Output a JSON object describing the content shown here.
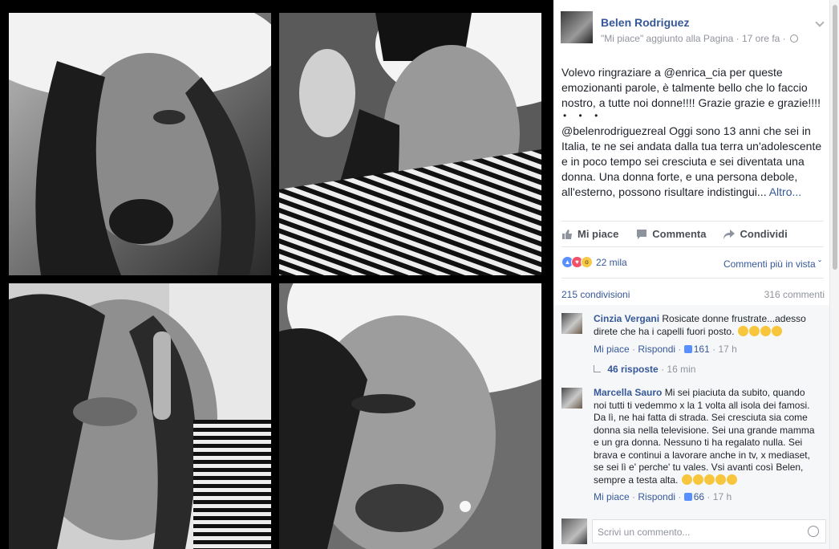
{
  "photos": [
    {
      "alt": "photo-1"
    },
    {
      "alt": "photo-2"
    },
    {
      "alt": "photo-3"
    },
    {
      "alt": "photo-4"
    }
  ],
  "post": {
    "author": "Belen Rodriguez",
    "meta": "\"Mi piace\" aggiunto alla Pagina · 17 ore fa ·",
    "text_1": "Volevo ringraziare a @enrica_cia per queste emozionanti parole, è talmente bello che lo faccio nostro, a tutte noi donne!!!! Grazie grazie e grazie!!!!",
    "dots": "• • •",
    "text_2": "@belenrodriguezreal Oggi sono 13 anni che sei in Italia, te ne sei andata dalla tua terra un'adolescente e in poco tempo sei cresciuta e sei diventata una donna. Una donna forte, e una persona debole, all'esterno, possono risultare indistingui...",
    "more": "Altro..."
  },
  "actions": {
    "like": "Mi piace",
    "comment": "Commenta",
    "share": "Condividi"
  },
  "stats": {
    "reactions": "22 mila",
    "sort": "Commenti più in vista ˇ",
    "shares": "215 condivisioni",
    "comments": "316 commenti"
  },
  "comments": [
    {
      "name": "Cinzia Vergani",
      "text": "Rosicate donne frustrate...adesso direte che ha i capelli fuori posto.",
      "like": "Mi piace",
      "reply": "Rispondi",
      "likes": "161",
      "time": "17 h",
      "replies": "46 risposte",
      "replies_time": "16 min"
    },
    {
      "name": "Marcella Sauro",
      "text": "Mi sei piaciuta da subito, quando noi tutti ti vedemmo x la 1 volta all isola dei famosi. Da lì, ne hai fatta di strada. Sei cresciuta sia come donna sia nella televisione. Sei una grande mamma e un gra donna. Nessuno ti ha regalato nulla. Sei brava e continui a lavorare anche in tv, x mediaset, se sei lì e' perche' tu vales. Vsi avanti così Belen, sempre a testa alta.",
      "like": "Mi piace",
      "reply": "Rispondi",
      "likes": "66",
      "time": "17 h"
    }
  ],
  "composer": {
    "placeholder": "Scrivi un commento..."
  },
  "colors": {
    "link": "#365899",
    "muted": "#90949c",
    "text": "#1d2129"
  }
}
